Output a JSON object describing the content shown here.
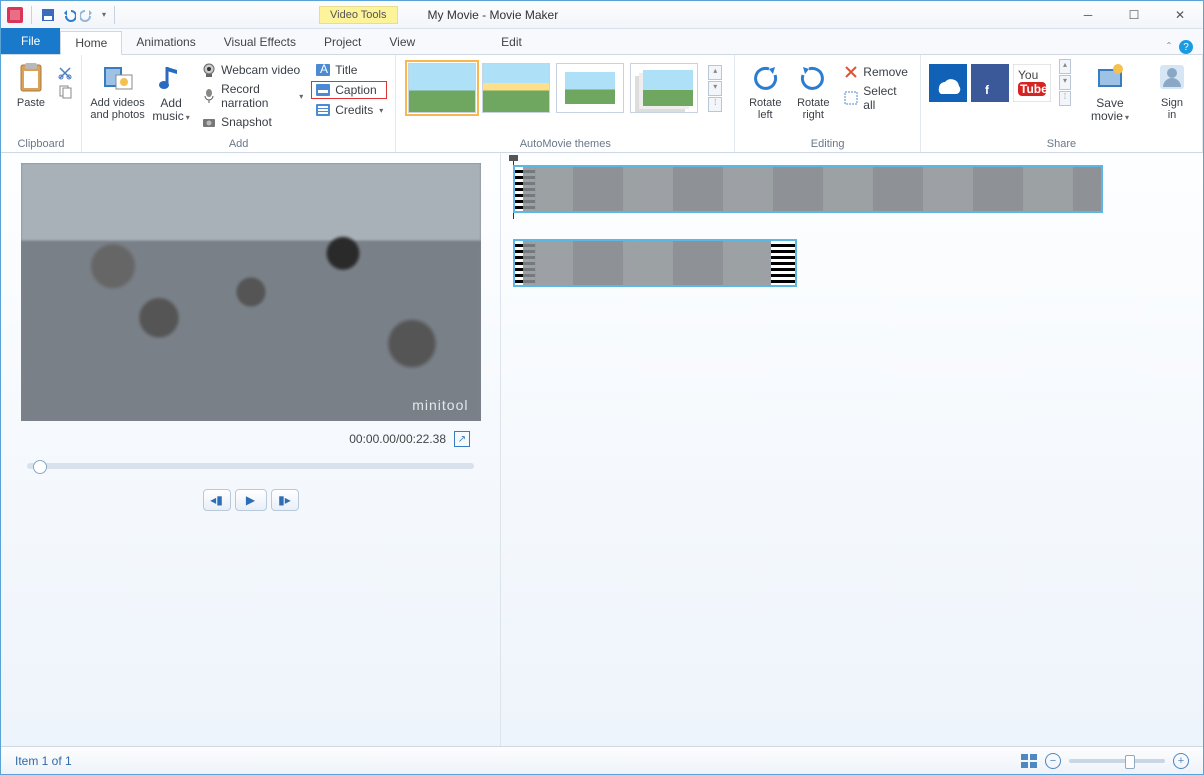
{
  "window": {
    "title": "My Movie - Movie Maker",
    "videoTools": "Video Tools"
  },
  "tabs": {
    "file": "File",
    "home": "Home",
    "animations": "Animations",
    "visualEffects": "Visual Effects",
    "project": "Project",
    "view": "View",
    "edit": "Edit"
  },
  "ribbon": {
    "clipboard": {
      "label": "Clipboard",
      "paste": "Paste"
    },
    "add": {
      "label": "Add",
      "addVideos": "Add videos\nand photos",
      "addMusic": "Add\nmusic",
      "webcam": "Webcam video",
      "narration": "Record narration",
      "snapshot": "Snapshot",
      "title": "Title",
      "caption": "Caption",
      "credits": "Credits"
    },
    "themes": {
      "label": "AutoMovie themes"
    },
    "editing": {
      "label": "Editing",
      "rotateLeft": "Rotate\nleft",
      "rotateRight": "Rotate\nright",
      "remove": "Remove",
      "selectAll": "Select all"
    },
    "share": {
      "label": "Share",
      "saveMovie": "Save\nmovie",
      "signIn": "Sign\nin"
    }
  },
  "preview": {
    "watermark": "minitool",
    "time": "00:00.00/00:22.38"
  },
  "status": {
    "text": "Item 1 of 1"
  }
}
